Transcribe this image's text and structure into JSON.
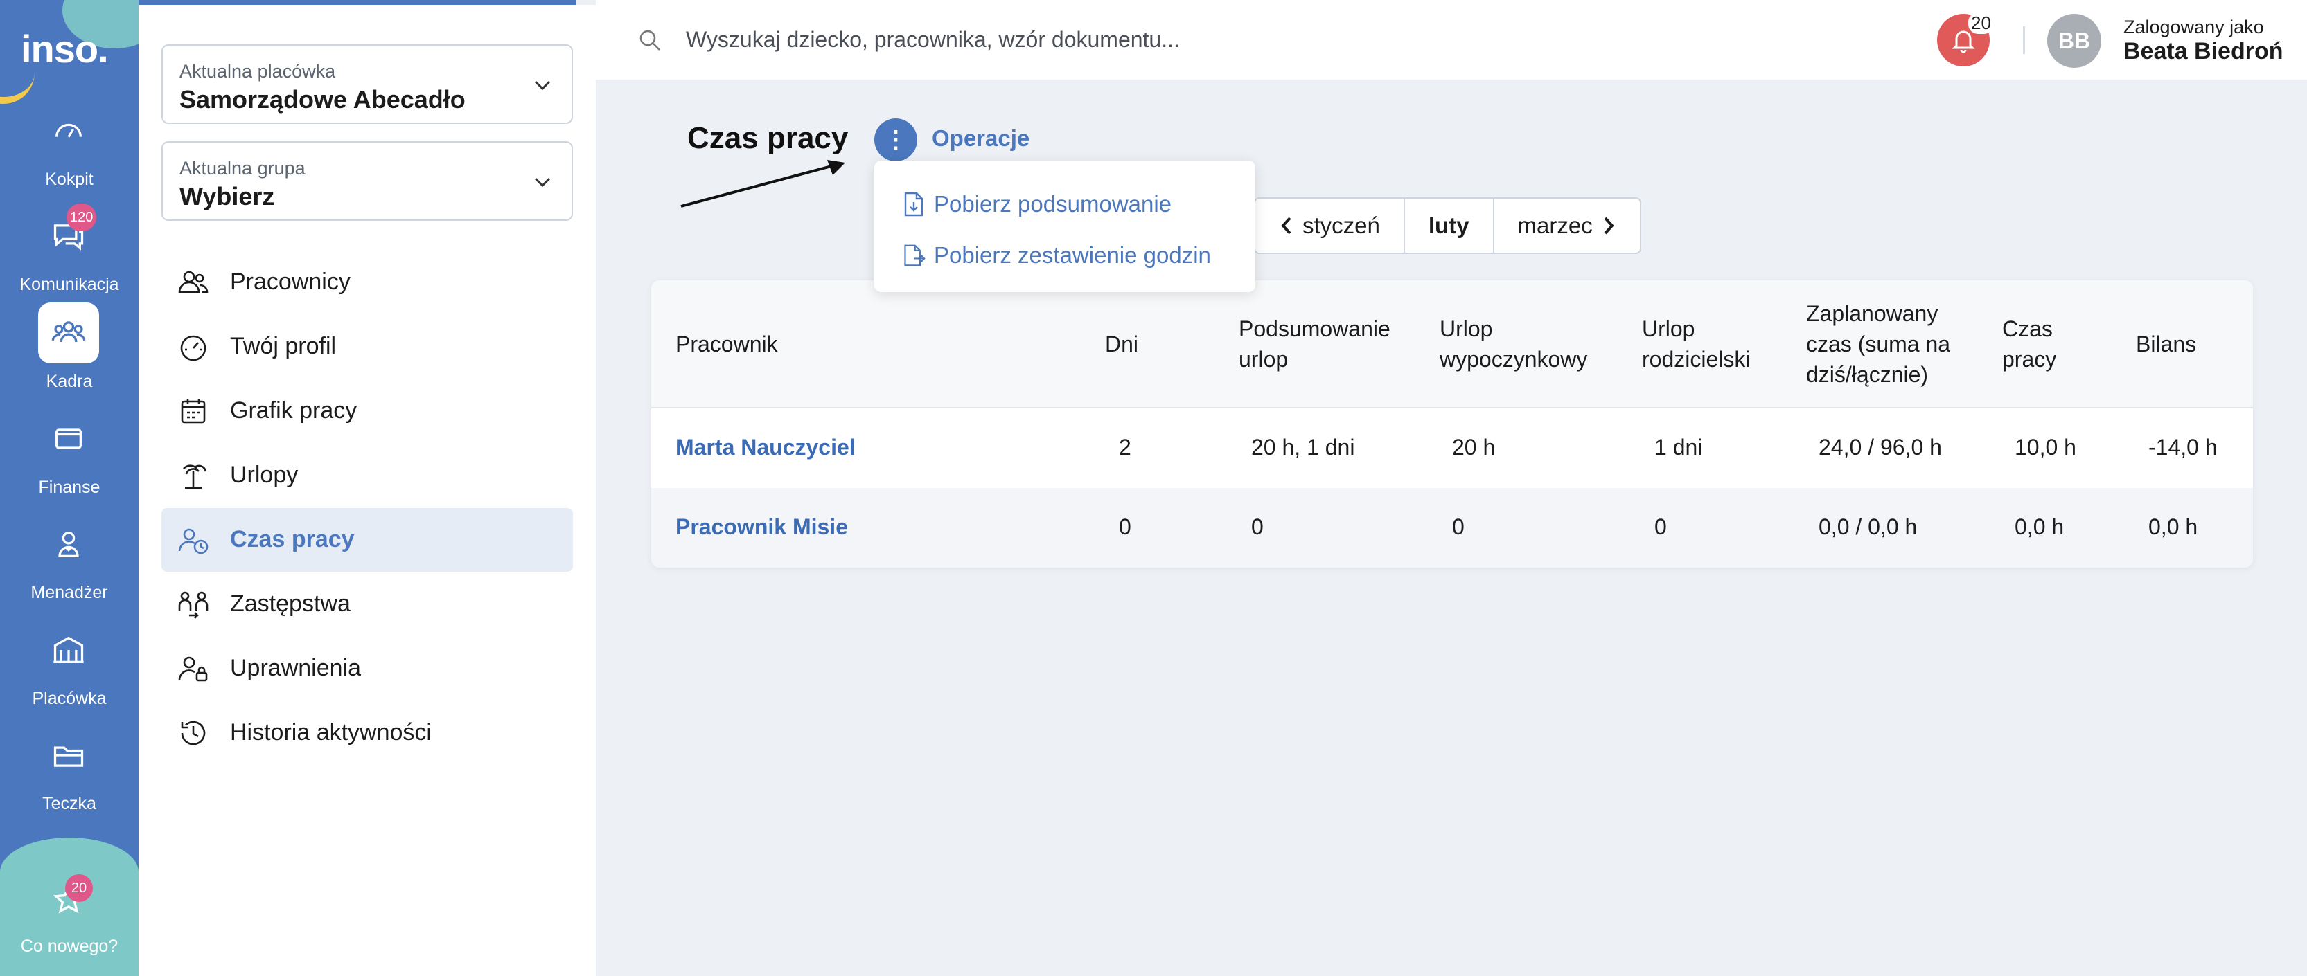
{
  "rail": {
    "logo": "inso.",
    "items": [
      {
        "label": "Kokpit",
        "icon": "gauge-icon"
      },
      {
        "label": "Komunikacja",
        "icon": "chat-icon",
        "badge": "120"
      },
      {
        "label": "Kadra",
        "icon": "people-icon"
      },
      {
        "label": "Finanse",
        "icon": "wallet-icon"
      },
      {
        "label": "Menadżer",
        "icon": "manager-icon"
      },
      {
        "label": "Placówka",
        "icon": "building-icon"
      },
      {
        "label": "Teczka",
        "icon": "folder-icon"
      }
    ],
    "whats_new": {
      "label": "Co nowego?",
      "badge": "20",
      "icon": "star-icon"
    }
  },
  "sidebar": {
    "facility": {
      "caption": "Aktualna placówka",
      "value": "Samorządowe Abecadło"
    },
    "group": {
      "caption": "Aktualna grupa",
      "value": "Wybierz"
    },
    "items": [
      {
        "label": "Pracownicy",
        "icon": "users-icon"
      },
      {
        "label": "Twój profil",
        "icon": "profile-gauge-icon"
      },
      {
        "label": "Grafik pracy",
        "icon": "calendar-icon"
      },
      {
        "label": "Urlopy",
        "icon": "palm-icon"
      },
      {
        "label": "Czas pracy",
        "icon": "user-clock-icon"
      },
      {
        "label": "Zastępstwa",
        "icon": "swap-users-icon"
      },
      {
        "label": "Uprawnienia",
        "icon": "user-lock-icon"
      },
      {
        "label": "Historia aktywności",
        "icon": "history-icon"
      }
    ]
  },
  "topbar": {
    "search_placeholder": "Wyszukaj dziecko, pracownika, wzór dokumentu...",
    "notifications": "20",
    "avatar_initials": "BB",
    "logged_caption": "Zalogowany jako",
    "logged_name": "Beata Biedroń"
  },
  "main": {
    "title": "Czas pracy",
    "operations_label": "Operacje",
    "dropdown": [
      "Pobierz podsumowanie",
      "Pobierz zestawienie godzin"
    ],
    "months": {
      "prev": "styczeń",
      "current": "luty",
      "next": "marzec"
    },
    "table": {
      "headers": [
        "Pracownik",
        "Dni",
        "Podsumowanie urlop",
        "Urlop wypoczynkowy",
        "Urlop rodzicielski",
        "Zaplanowany czas (suma na dziś/łącznie)",
        "Czas pracy",
        "Bilans"
      ],
      "rows": [
        [
          "Marta Nauczyciel",
          "2",
          "20 h, 1 dni",
          "20 h",
          "1 dni",
          "24,0 / 96,0 h",
          "10,0 h",
          "-14,0 h"
        ],
        [
          "Pracownik Misie",
          "0",
          "0",
          "0",
          "0",
          "0,0 / 0,0 h",
          "0,0 h",
          "0,0 h"
        ]
      ]
    }
  },
  "colors": {
    "primary": "#4a77bd",
    "badge": "#e0578a",
    "bell": "#e05a5a",
    "teal": "#7ec9c7"
  }
}
